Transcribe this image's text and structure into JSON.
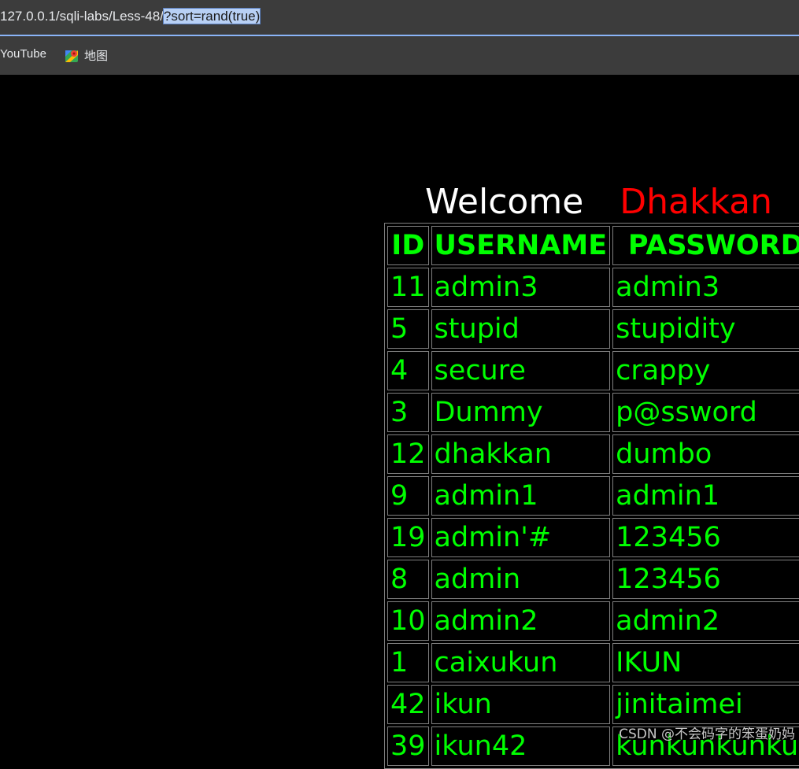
{
  "browser": {
    "url_base": "127.0.0.1/sqli-labs/Less-48/",
    "url_selected": "?sort=rand(true)",
    "bookmarks": [
      {
        "label": "YouTube",
        "icon": "none"
      },
      {
        "label": "地图",
        "icon": "maps-icon"
      }
    ]
  },
  "page": {
    "welcome": "Welcome",
    "name": "Dhakkan",
    "colors": {
      "background": "#000000",
      "text": "#00ff00",
      "name": "#ff0000",
      "welcome": "#ffffff"
    }
  },
  "table": {
    "headers": [
      "ID",
      "USERNAME",
      "PASSWORD"
    ],
    "rows": [
      [
        "11",
        "admin3",
        "admin3"
      ],
      [
        "5",
        "stupid",
        "stupidity"
      ],
      [
        "4",
        "secure",
        "crappy"
      ],
      [
        "3",
        "Dummy",
        "p@ssword"
      ],
      [
        "12",
        "dhakkan",
        "dumbo"
      ],
      [
        "9",
        "admin1",
        "admin1"
      ],
      [
        "19",
        "admin'#",
        "123456"
      ],
      [
        "8",
        "admin",
        "123456"
      ],
      [
        "10",
        "admin2",
        "admin2"
      ],
      [
        "1",
        "caixukun",
        "IKUN"
      ],
      [
        "42",
        "ikun",
        "jinitaimei"
      ],
      [
        "39",
        "ikun42",
        "kunkunkunkun"
      ]
    ]
  },
  "watermark": "CSDN @不会码字的笨蛋奶妈"
}
